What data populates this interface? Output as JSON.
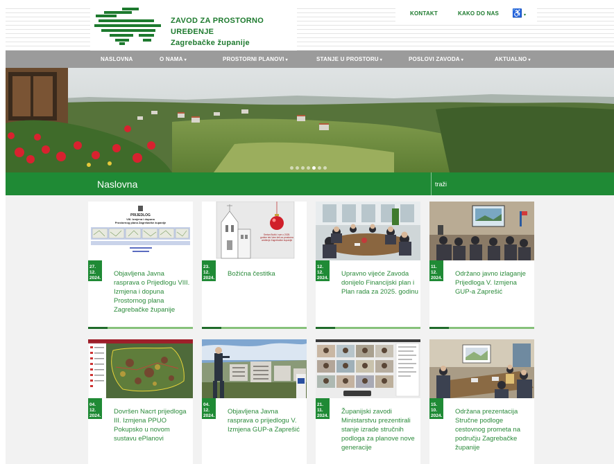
{
  "site": {
    "name_line1": "ZAVOD ZA PROSTORNO UREĐENJE",
    "name_line2": "Zagrebačke županije"
  },
  "top_links": [
    {
      "label": "KONTAKT"
    },
    {
      "label": "KAKO DO NAS"
    }
  ],
  "accessibility": {
    "icon": "accessibility-icon",
    "glyph": "♿"
  },
  "nav": [
    {
      "label": "NASLOVNA",
      "caret": ""
    },
    {
      "label": "O NAMA",
      "caret": "▾"
    },
    {
      "label": "PROSTORNI PLANOVI",
      "caret": "▾"
    },
    {
      "label": "STANJE U PROSTORU",
      "caret": "▾"
    },
    {
      "label": "POSLOVI ZAVODA",
      "caret": "▾"
    },
    {
      "label": "AKTUALNO",
      "caret": "▾"
    }
  ],
  "page": {
    "title": "Naslovna"
  },
  "search": {
    "placeholder": "traži"
  },
  "carousel": {
    "slides": 7,
    "active_index": 5
  },
  "news": [
    {
      "date_day": "27. 12.",
      "date_year": "2024.",
      "title": "Objavljena Javna rasprava o Prijedlogu VIII. Izmjena i dopuna Prostornog plana Zagrebačke županije",
      "thumb": {
        "heading1": "PRIJEDLOG",
        "heading2": "VIII. Izmjena i dopuna",
        "heading3": "Prostornog plana Zagrebačke županije"
      }
    },
    {
      "date_day": "23. 12.",
      "date_year": "2024.",
      "title": "Božićna čestitka",
      "thumb": {
        "greeting": "Sretan Božić i sve u 2025. godine tek Vam želi za prostorna uređenje Zagrebačke županije"
      }
    },
    {
      "date_day": "12. 12.",
      "date_year": "2024.",
      "title": "Upravno vijeće Zavoda donijelo Financijski plan i Plan rada za 2025. godinu"
    },
    {
      "date_day": "11. 12.",
      "date_year": "2024.",
      "title": "Održano javno izlaganje Prijedloga V. Izmjena GUP-a Zaprešić"
    },
    {
      "date_day": "04. 12.",
      "date_year": "2024.",
      "title": "Dovršen Nacrt prijedloga III. Izmjena PPUO Pokupsko u novom sustavu ePlanovi"
    },
    {
      "date_day": "04. 12.",
      "date_year": "2024.",
      "title": "Objavljena Javna rasprava o prijedlogu V. Izmjena GUP-a Zaprešić"
    },
    {
      "date_day": "21. 11.",
      "date_year": "2024.",
      "title": "Županijski zavodi Ministarstvu prezentirali stanje izrade stručnih podloga za planove nove generacije"
    },
    {
      "date_day": "15. 10.",
      "date_year": "2024.",
      "title": "Održana prezentacija Stručne podloge cestovnog prometa na području Zagrebačke županije"
    }
  ],
  "colors": {
    "brand_green": "#1f8a35",
    "nav_gray": "#9b9b9b",
    "card_bar": "#86c17a"
  }
}
